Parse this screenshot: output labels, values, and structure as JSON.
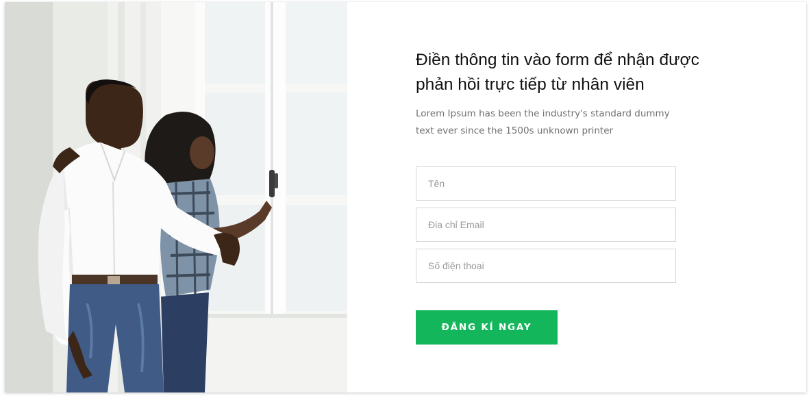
{
  "contact_section": {
    "heading_line1": "Điền thông tin vào form để nhận được",
    "heading_line2": "phản hồi trực tiếp từ nhân viên",
    "subtext_line1": "Lorem Ipsum has been the industry's standard dummy",
    "subtext_line2": "text ever since the 1500s unknown printer",
    "fields": {
      "name_placeholder": "Tên",
      "email_placeholder": "Đia chỉ Email",
      "phone_placeholder": "Số điện thoại",
      "name_value": "",
      "email_value": "",
      "phone_value": ""
    },
    "submit_label": "ĐĂNG KÍ NGAY",
    "accent_color": "#13b65b"
  },
  "photo": {
    "icon": "couple-at-window-photo"
  }
}
